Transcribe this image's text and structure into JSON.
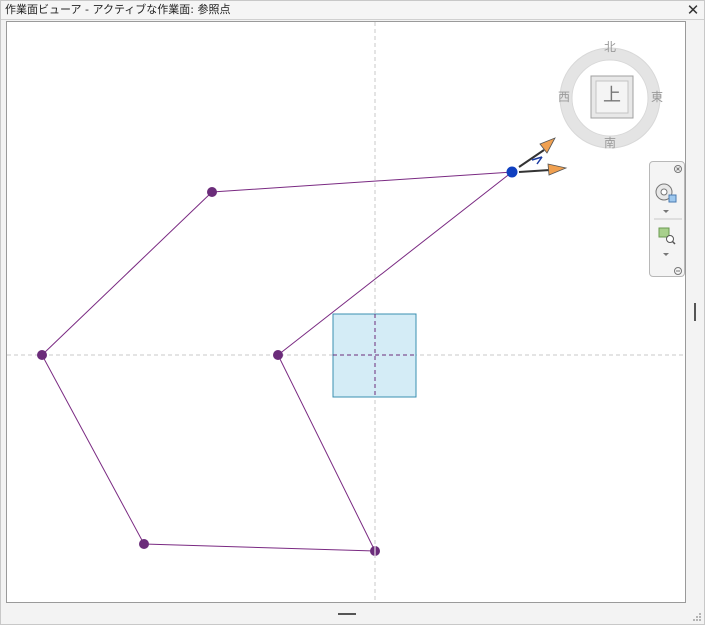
{
  "window": {
    "title": "作業面ビューア - アクティブな作業面: 参照点"
  },
  "viewcube": {
    "face": "上",
    "north": "北",
    "south": "南",
    "east": "東",
    "west": "西"
  },
  "icons": {
    "close": "close-icon",
    "steering_wheel": "steering-wheel-icon",
    "zoom": "zoom-icon",
    "dropdown": "chevron-down-icon",
    "navbar_close": "close-icon"
  },
  "colors": {
    "curve": "#7a2a82",
    "point": "#6b2c7a",
    "selected_point": "#1040c0",
    "workplane_fill": "#d4ecf6",
    "workplane_border": "#3a8fb0",
    "arrow": "#f0a050"
  }
}
